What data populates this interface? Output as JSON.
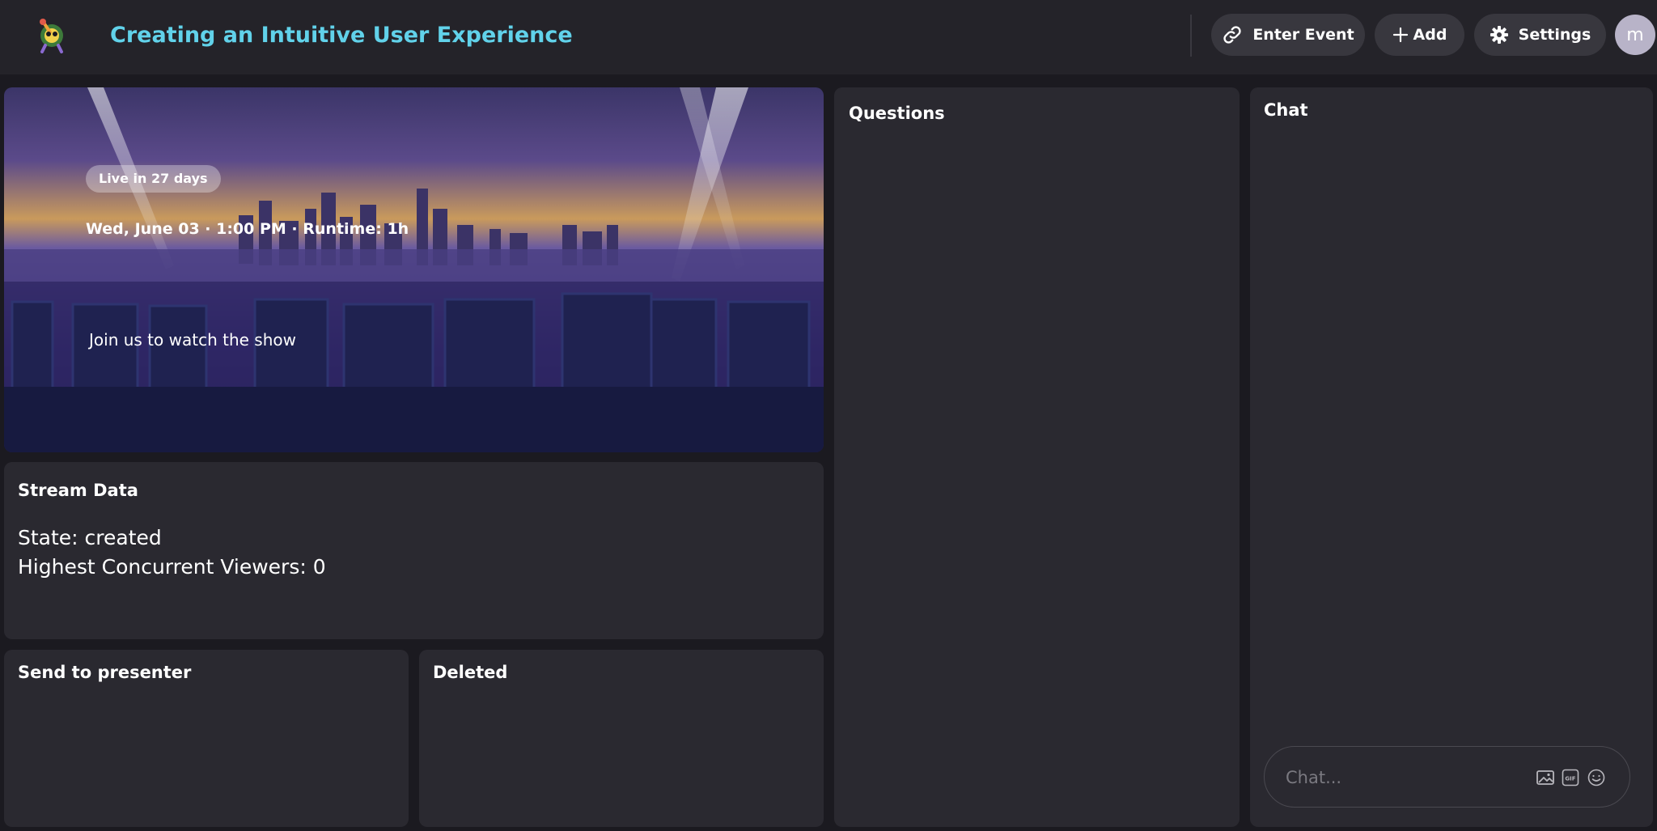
{
  "header": {
    "title": "Creating an Intuitive User Experience",
    "buttons": {
      "enter_event": "Enter Event",
      "add": "Add",
      "settings": "Settings"
    },
    "avatar_initial": "m"
  },
  "hero": {
    "live_badge": "Live in 27 days",
    "schedule": "Wed, June 03 · 1:00 PM · Runtime: 1h",
    "description": "Join us to watch the show"
  },
  "stream_data": {
    "title": "Stream Data",
    "state": "State: created",
    "viewers": "Highest Concurrent Viewers: 0"
  },
  "panels": {
    "send_to_presenter": "Send to presenter",
    "deleted": "Deleted",
    "questions": "Questions",
    "chat": "Chat"
  },
  "chat_input": {
    "placeholder": "Chat...",
    "icons": [
      "image-icon",
      "gif-icon",
      "emoji-icon"
    ]
  },
  "colors": {
    "accent": "#61d2ea",
    "background": "#1b1a20",
    "panel": "#2a2930",
    "button": "#38373e"
  }
}
